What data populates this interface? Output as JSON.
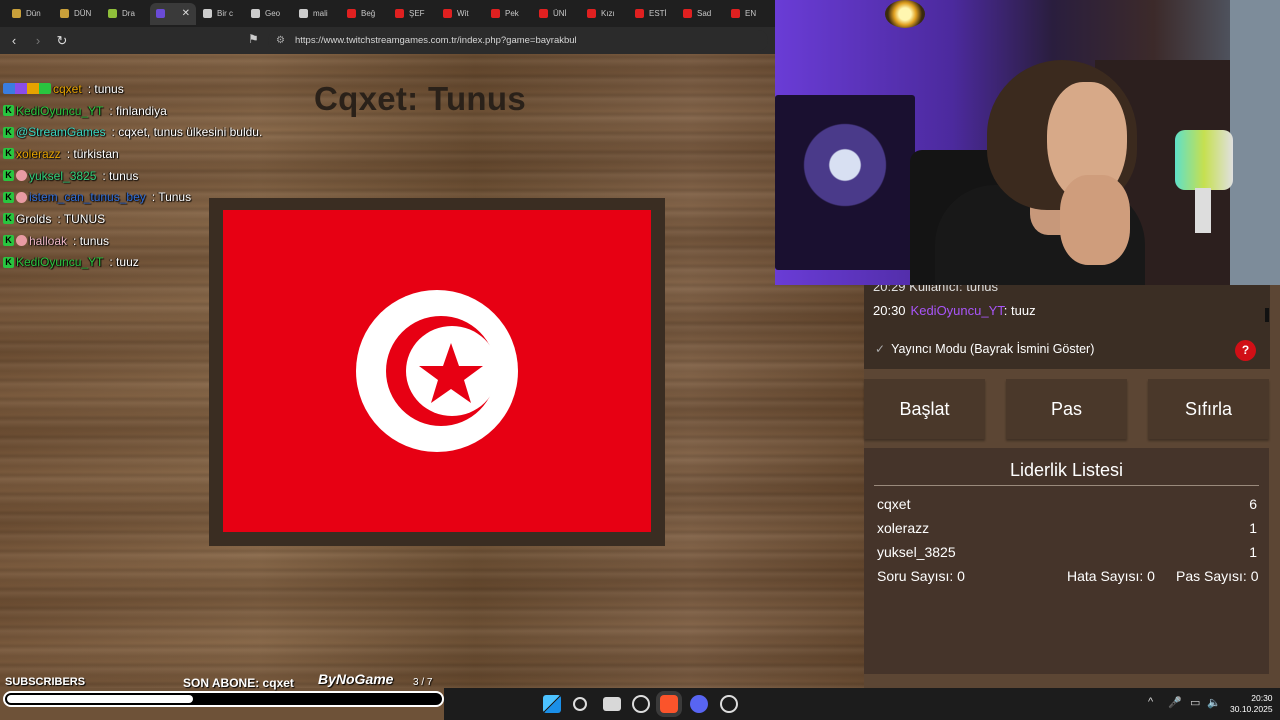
{
  "browser": {
    "tabs": [
      {
        "label": "Dün",
        "color": "#c9a03a"
      },
      {
        "label": "DÜN",
        "color": "#c9a03a"
      },
      {
        "label": "Dra",
        "color": "#8fbf3a"
      },
      {
        "label": "",
        "color": "#6a4bd6",
        "active": true
      },
      {
        "label": "Bir c",
        "color": "#cccccc"
      },
      {
        "label": "Geo",
        "color": "#cccccc"
      },
      {
        "label": "mali",
        "color": "#cccccc"
      },
      {
        "label": "Beğ",
        "color": "#e02020"
      },
      {
        "label": "ŞEF",
        "color": "#e02020"
      },
      {
        "label": "Wit",
        "color": "#e02020"
      },
      {
        "label": "Pek",
        "color": "#e02020"
      },
      {
        "label": "ÜNİ",
        "color": "#e02020"
      },
      {
        "label": "Kızı",
        "color": "#e02020"
      },
      {
        "label": "ESTİ",
        "color": "#e02020"
      },
      {
        "label": "Sad",
        "color": "#e02020"
      },
      {
        "label": "EN",
        "color": "#e02020"
      }
    ],
    "close_glyph": "✕",
    "back_glyph": "‹",
    "forward_glyph": "›",
    "reload_glyph": "↻",
    "bookmark_glyph": "⚑",
    "tune_glyph": "⚙",
    "url": "https://www.twitchstreamgames.com.tr/index.php?game=bayrakbul"
  },
  "game": {
    "title": "Cqxet: Tunus",
    "flag_colors": {
      "red": "#e70013",
      "white": "#ffffff"
    }
  },
  "chat_overlay": [
    {
      "badges": [
        "multi"
      ],
      "user": "cqxet",
      "user_color": "#e6a300",
      "text": ": tunus"
    },
    {
      "badges": [
        "k"
      ],
      "user": "KediOyuncu_YT",
      "user_color": "#29c53f",
      "text": ": finlandiya"
    },
    {
      "badges": [
        "k"
      ],
      "user": "@StreamGames",
      "user_color": "#3ad6c0",
      "text": ": cqxet, tunus ülkesini buldu."
    },
    {
      "badges": [
        "k"
      ],
      "user": "xolerazz",
      "user_color": "#e6a300",
      "text": ": türkistan"
    },
    {
      "badges": [
        "k",
        "mod"
      ],
      "user": "yuksel_3825",
      "user_color": "#2fcf7a",
      "text": ": tunus"
    },
    {
      "badges": [
        "k",
        "mod"
      ],
      "user": "istem_can_tunus_bey",
      "user_color": "#2f6cd6",
      "text": ": Tunus"
    },
    {
      "badges": [
        "k"
      ],
      "user": "Grolds",
      "user_color": "#ffffff",
      "text": ": TUNUS"
    },
    {
      "badges": [
        "k",
        "mod"
      ],
      "user": "halloak",
      "user_color": "#f0b8c8",
      "text": ": tunus"
    },
    {
      "badges": [
        "k"
      ],
      "user": "KediOyuncu_YT",
      "user_color": "#29c53f",
      "text": ": tuuz"
    }
  ],
  "stream_bar": {
    "subscribers_label": "SUBSCRIBERS",
    "last_sub": "SON ABONE: cqxet",
    "brand": "ByNoGame",
    "counter": "3 / 7",
    "progress": 0.43
  },
  "panel": {
    "chat_cut_text": "20:29  Kullanıcı: tunus",
    "chat_time": "20:30",
    "chat_user": "KediOyuncu_YT",
    "chat_text": ": tuuz",
    "streamer_mode": "Yayıncı Modu (Bayrak İsmini Göster)",
    "check_glyph": "✓",
    "help": "?",
    "buttons": {
      "start": "Başlat",
      "pass": "Pas",
      "reset": "Sıfırla"
    },
    "leaderboard": {
      "title": "Liderlik Listesi",
      "rows": [
        {
          "name": "cqxet",
          "score": "6"
        },
        {
          "name": "xolerazz",
          "score": "1"
        },
        {
          "name": "yuksel_3825",
          "score": "1"
        }
      ],
      "question_count": "Soru Sayısı: 0",
      "error_count": "Hata Sayısı: 0",
      "pass_count": "Pas Sayısı: 0"
    }
  },
  "taskbar": {
    "time": "20:30",
    "date": "30.10.2025",
    "tray_glyphs": {
      "chevron": "^",
      "mic": "🎤",
      "network": "▭",
      "volume": "🔈"
    }
  }
}
